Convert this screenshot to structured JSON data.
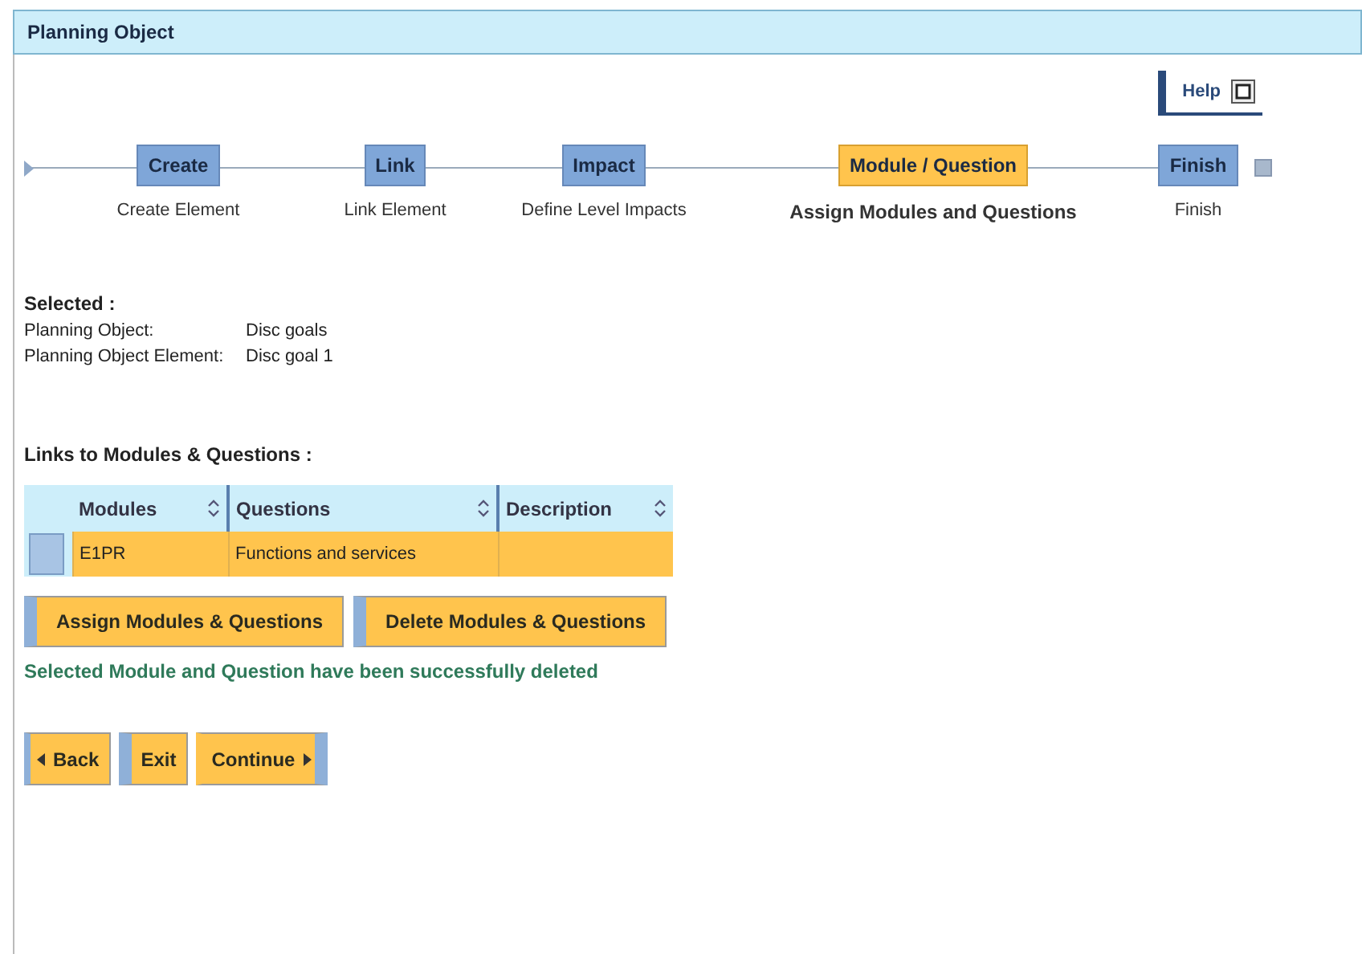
{
  "window": {
    "title": "Planning Object"
  },
  "help": {
    "label": "Help"
  },
  "steps": [
    {
      "label": "Create",
      "description": "Create Element",
      "selected": false
    },
    {
      "label": "Link",
      "description": "Link Element",
      "selected": false
    },
    {
      "label": "Impact",
      "description": "Define Level Impacts",
      "selected": false
    },
    {
      "label": "Module / Question",
      "description": "Assign Modules and Questions",
      "selected": true
    },
    {
      "label": "Finish",
      "description": "Finish",
      "selected": false
    }
  ],
  "selected_section": {
    "title": "Selected :",
    "fields": [
      {
        "label": "Planning Object:",
        "value": "Disc goals"
      },
      {
        "label": "Planning Object Element:",
        "value": "Disc goal 1"
      }
    ]
  },
  "links_section": {
    "title": "Links to Modules & Questions :"
  },
  "table": {
    "columns": [
      "Modules",
      "Questions",
      "Description"
    ],
    "rows": [
      {
        "cells": [
          "E1PR",
          "Functions and services",
          ""
        ],
        "selected": true
      }
    ]
  },
  "actions": [
    "Assign Modules & Questions",
    "Delete Modules & Questions"
  ],
  "message": "Selected Module and Question have been successfully deleted",
  "nav": [
    {
      "label": "Back",
      "kind": "back"
    },
    {
      "label": "Exit",
      "kind": "plain"
    },
    {
      "label": "Continue",
      "kind": "next"
    }
  ]
}
